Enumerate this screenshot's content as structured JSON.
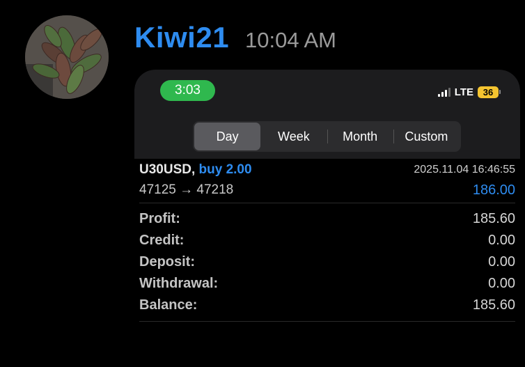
{
  "message": {
    "username": "Kiwi21",
    "time": "10:04 AM"
  },
  "status_bar": {
    "time": "3:03",
    "network": "LTE",
    "battery": "36",
    "colors": {
      "time_pill": "#2fb84e",
      "battery": "#f4c430"
    }
  },
  "period_tabs": {
    "items": [
      {
        "label": "Day",
        "active": true
      },
      {
        "label": "Week",
        "active": false
      },
      {
        "label": "Month",
        "active": false
      },
      {
        "label": "Custom",
        "active": false
      }
    ]
  },
  "trade": {
    "symbol": "U30USD,",
    "side": "buy 2.00",
    "datetime": "2025.11.04 16:46:55",
    "prices": "47125 → 47218",
    "profit": "186.00"
  },
  "summary": {
    "rows": [
      {
        "label": "Profit:",
        "value": "185.60"
      },
      {
        "label": "Credit:",
        "value": "0.00"
      },
      {
        "label": "Deposit:",
        "value": "0.00"
      },
      {
        "label": "Withdrawal:",
        "value": "0.00"
      },
      {
        "label": "Balance:",
        "value": "185.60"
      }
    ]
  },
  "colors": {
    "accent": "#2e8cf0",
    "background": "#000000"
  }
}
